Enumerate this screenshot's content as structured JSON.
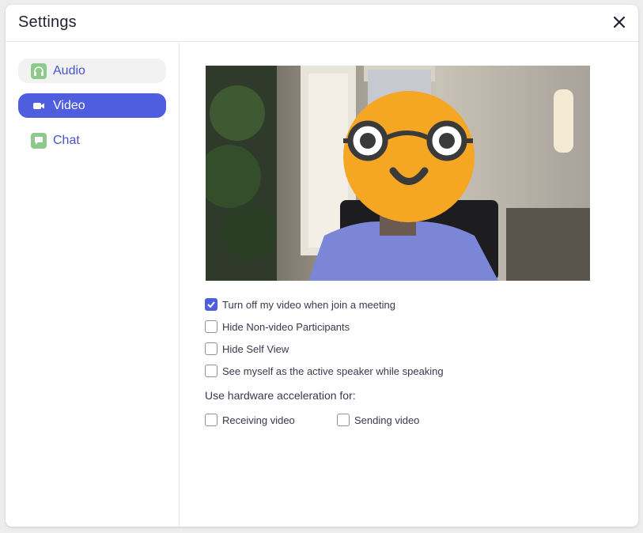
{
  "window": {
    "title": "Settings"
  },
  "sidebar": {
    "items": [
      {
        "label": "Audio",
        "icon": "headphones-icon",
        "state": "hover"
      },
      {
        "label": "Video",
        "icon": "camera-icon",
        "state": "active"
      },
      {
        "label": "Chat",
        "icon": "chat-icon",
        "state": "normal"
      }
    ]
  },
  "video": {
    "options": [
      {
        "label": "Turn off my video when join a meeting",
        "checked": true
      },
      {
        "label": "Hide Non-video Participants",
        "checked": false
      },
      {
        "label": "Hide Self View",
        "checked": false
      },
      {
        "label": "See myself as the active speaker while speaking",
        "checked": false
      }
    ],
    "hardware_label": "Use hardware acceleration for:",
    "hardware": [
      {
        "label": "Receiving video",
        "checked": false
      },
      {
        "label": "Sending video",
        "checked": false
      }
    ]
  },
  "colors": {
    "accent": "#4f5ede",
    "nav_text": "#4a53cc",
    "icon_green": "#8cc98a",
    "emoji": "#f5a623"
  }
}
